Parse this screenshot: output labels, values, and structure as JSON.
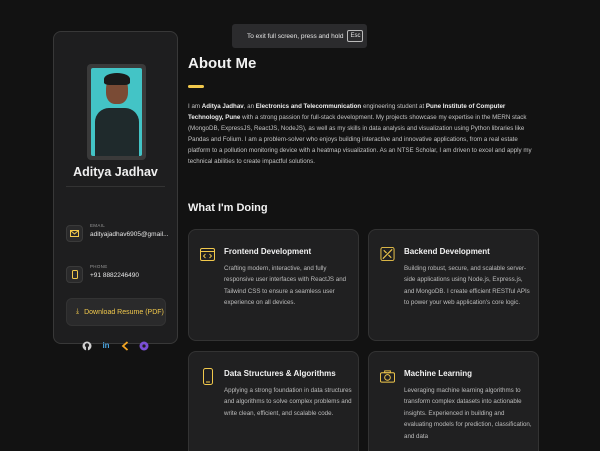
{
  "toast": {
    "text": "To exit full screen, press and hold",
    "key": "Esc"
  },
  "sidebar": {
    "name": "Aditya Jadhav",
    "email_label": "EMAIL",
    "email_value": "adityajadhav6905@gmail...",
    "phone_label": "PHONE",
    "phone_value": "+91 8882246490",
    "resume_label": "Download Resume (PDF)",
    "socials": [
      "github-icon",
      "linkedin-icon",
      "leetcode-icon",
      "codechef-icon"
    ]
  },
  "main": {
    "title": "About Me",
    "about_parts": {
      "p1": "I am ",
      "name": "Aditya Jadhav",
      "p2": ", an ",
      "field": "Electronics and Telecommunication",
      "p3": " engineering student at ",
      "college": "Pune Institute of Computer Technology, Pune",
      "p4": " with a strong passion for full-stack development. My projects showcase my expertise in the MERN stack (MongoDB, ExpressJS, ReactJS, NodeJS), as well as my skills in data analysis and visualization using Python libraries like Pandas and Folium. I am a problem-solver who enjoys building interactive and innovative applications, from a real estate platform to a pollution monitoring device with a heatmap visualization. As an NTSE Scholar, I am driven to excel and apply my technical abilities to create impactful solutions."
    },
    "section_title": "What I'm Doing",
    "cards": [
      {
        "title": "Frontend Development",
        "desc": "Crafting modern, interactive, and fully responsive user interfaces with ReactJS and Tailwind CSS to ensure a seamless user experience on all devices."
      },
      {
        "title": "Backend Development",
        "desc": "Building robust, secure, and scalable server-side applications using Node.js, Express.js, and MongoDB. I create efficient RESTful APIs to power your web application's core logic."
      },
      {
        "title": "Data Structures & Algorithms",
        "desc": "Applying a strong foundation in data structures and algorithms to solve complex problems and write clean, efficient, and scalable code."
      },
      {
        "title": "Machine Learning",
        "desc": "Leveraging machine learning algorithms to transform complex datasets into actionable insights. Experienced in building and evaluating models for prediction, classification, and data"
      }
    ]
  },
  "colors": {
    "accent": "#f2c94c",
    "background": "#121212",
    "card": "#202021"
  }
}
